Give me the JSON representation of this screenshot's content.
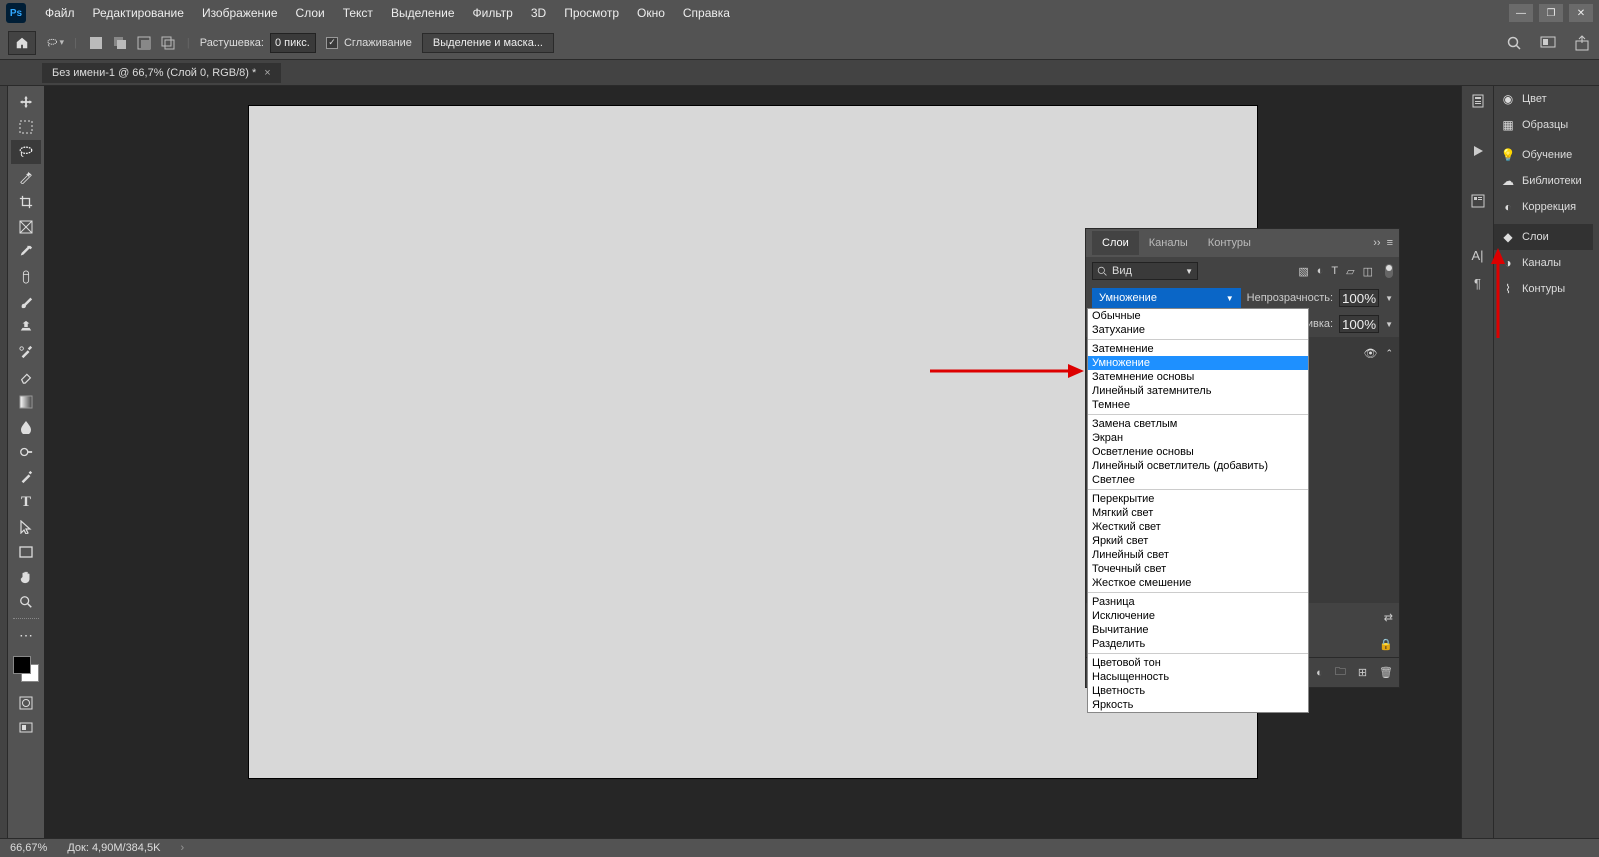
{
  "menubar": {
    "items": [
      "Файл",
      "Редактирование",
      "Изображение",
      "Слои",
      "Текст",
      "Выделение",
      "Фильтр",
      "3D",
      "Просмотр",
      "Окно",
      "Справка"
    ]
  },
  "optbar": {
    "feather_label": "Растушевка:",
    "feather_value": "0 пикс.",
    "antialias_label": "Сглаживание",
    "select_mask": "Выделение и маска..."
  },
  "doc_tab": {
    "title": "Без имени-1 @ 66,7% (Слой 0, RGB/8) *"
  },
  "right_col": {
    "items": [
      {
        "icon": "color-icon",
        "label": "Цвет"
      },
      {
        "icon": "swatches-icon",
        "label": "Образцы"
      },
      {
        "icon": "learn-icon",
        "label": "Обучение"
      },
      {
        "icon": "libraries-icon",
        "label": "Библиотеки"
      },
      {
        "icon": "adjustments-icon",
        "label": "Коррекция"
      },
      {
        "icon": "layers-icon",
        "label": "Слои",
        "active": true
      },
      {
        "icon": "channels-icon",
        "label": "Каналы"
      },
      {
        "icon": "paths-icon",
        "label": "Контуры"
      }
    ]
  },
  "layers_panel": {
    "tabs": [
      "Слои",
      "Каналы",
      "Контуры"
    ],
    "kind_label": "Вид",
    "blend_selected": "Умножение",
    "opacity_label": "Непрозрачность:",
    "opacity_value": "100%",
    "fill_label": "Заливка:",
    "fill_value": "100%"
  },
  "blend_modes": {
    "groups": [
      [
        "Обычные",
        "Затухание"
      ],
      [
        "Затемнение",
        "Умножение",
        "Затемнение основы",
        "Линейный затемнитель",
        "Темнее"
      ],
      [
        "Замена светлым",
        "Экран",
        "Осветление основы",
        "Линейный осветлитель (добавить)",
        "Светлее"
      ],
      [
        "Перекрытие",
        "Мягкий свет",
        "Жесткий свет",
        "Яркий свет",
        "Линейный свет",
        "Точечный свет",
        "Жесткое смешение"
      ],
      [
        "Разница",
        "Исключение",
        "Вычитание",
        "Разделить"
      ],
      [
        "Цветовой тон",
        "Насыщенность",
        "Цветность",
        "Яркость"
      ]
    ],
    "highlighted": "Умножение"
  },
  "status": {
    "zoom": "66,67%",
    "doc_label": "Док:",
    "doc_size": "4,90M/384,5K"
  }
}
